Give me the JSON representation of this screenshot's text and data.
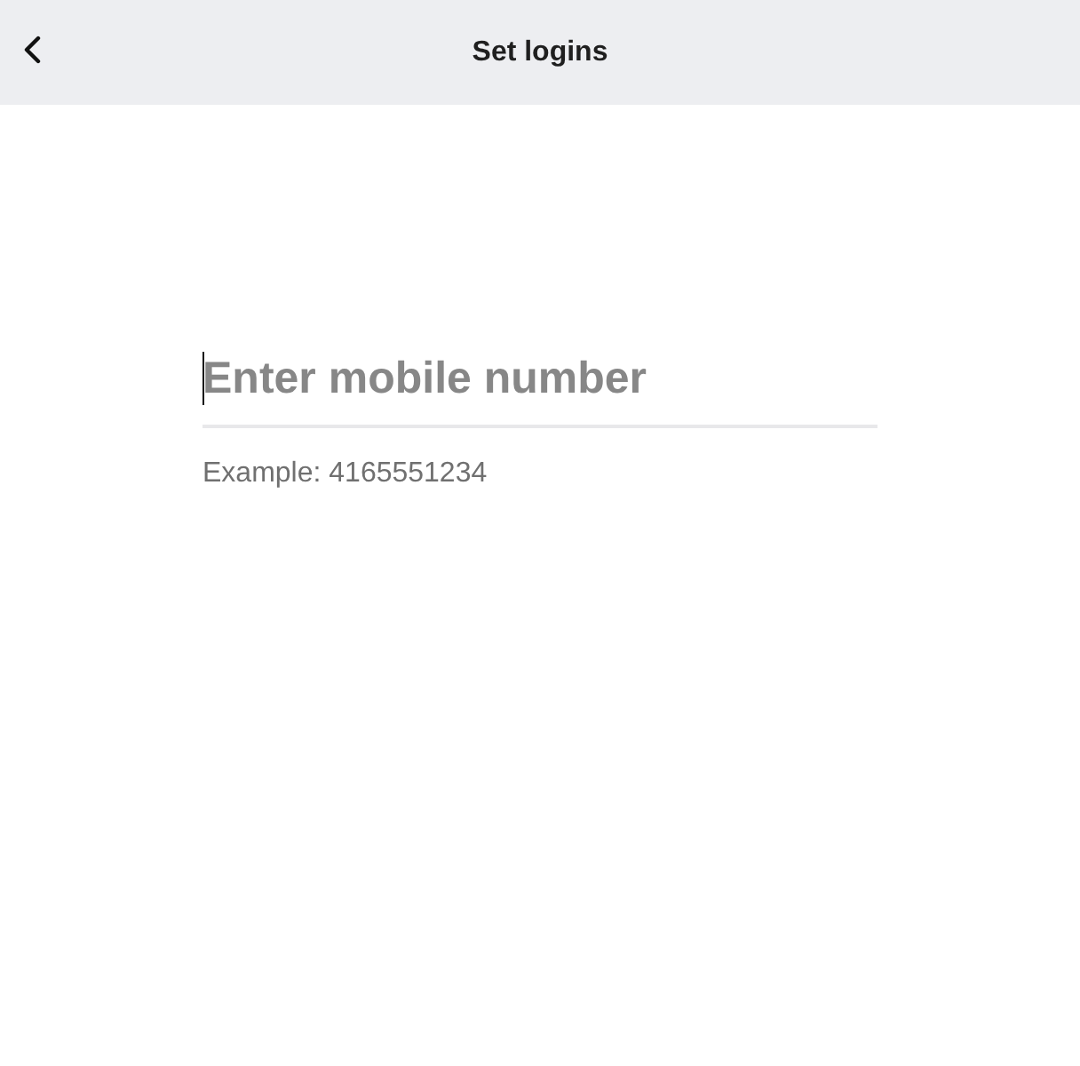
{
  "header": {
    "title": "Set logins"
  },
  "phone_field": {
    "placeholder": "Enter mobile number",
    "focused": true,
    "hint": "Example: 4165551234"
  }
}
